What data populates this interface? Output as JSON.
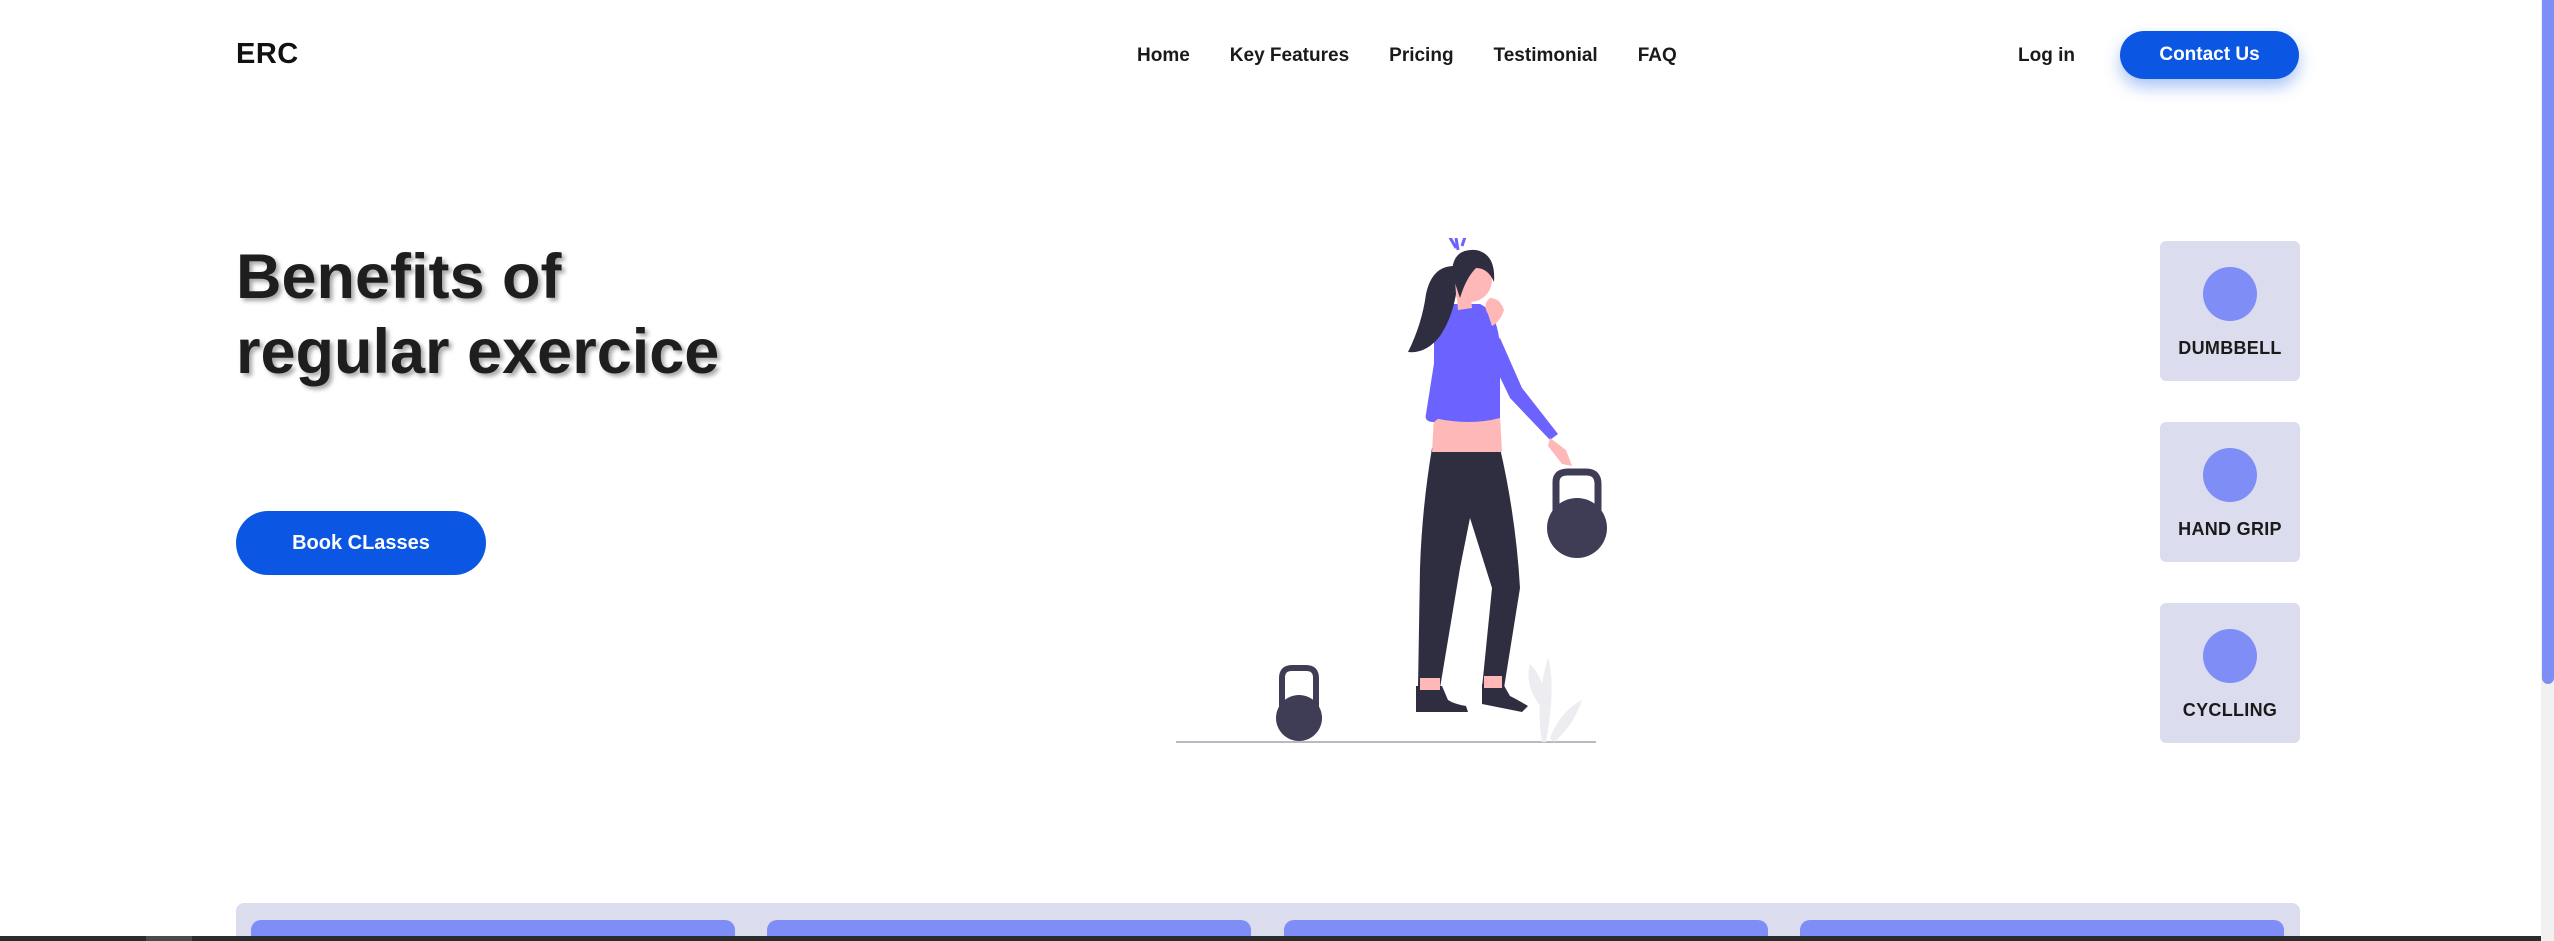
{
  "brand": {
    "logo": "ERC"
  },
  "nav": {
    "items": [
      "Home",
      "Key Features",
      "Pricing",
      "Testimonial",
      "FAQ"
    ],
    "login": "Log in",
    "contact": "Contact Us"
  },
  "hero": {
    "title": "Benefits of regular exercice",
    "cta": "Book CLasses"
  },
  "categories": [
    {
      "label": "DUMBBELL"
    },
    {
      "label": "HAND GRIP"
    },
    {
      "label": "CYCLLING"
    }
  ],
  "colors": {
    "primary": "#0b57e3",
    "accent": "#7f8ef6",
    "card_bg": "#dcdcef",
    "illustration_purple": "#6c63ff",
    "illustration_dark": "#2f2e41",
    "skin": "#ffb8b8"
  }
}
